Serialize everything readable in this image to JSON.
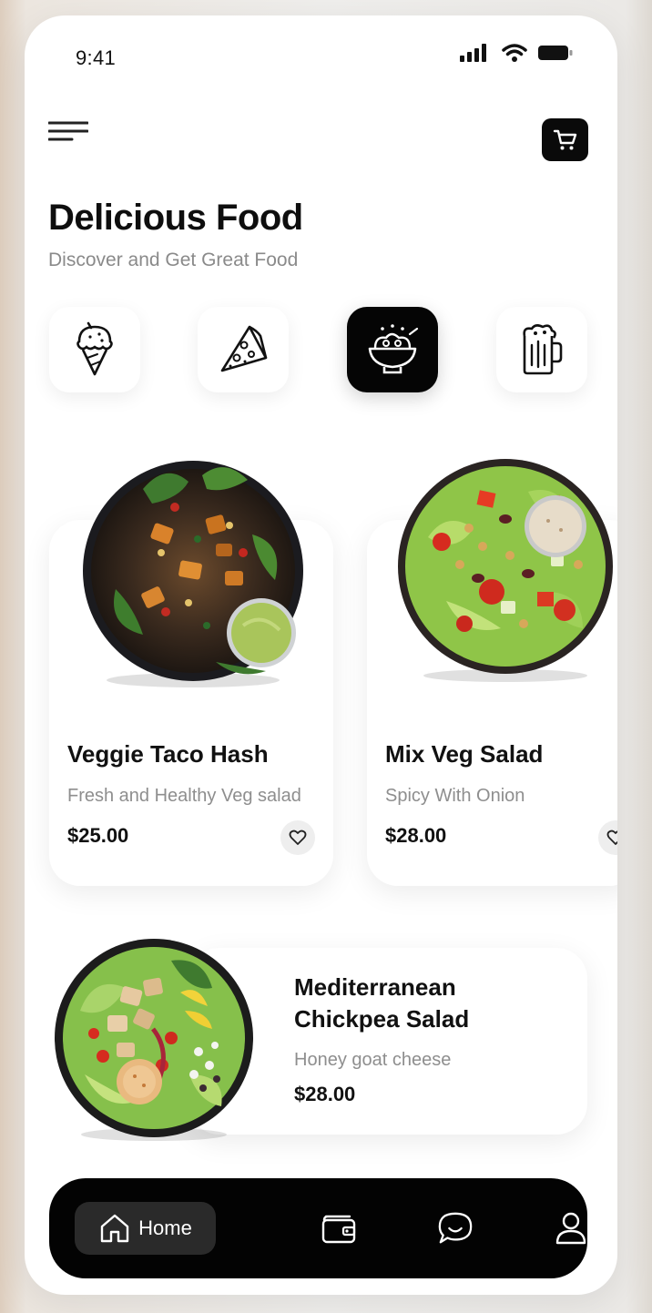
{
  "status_bar": {
    "time": "9:41"
  },
  "header": {
    "title": "Delicious Food",
    "subtitle": "Discover and Get Great Food"
  },
  "categories": [
    {
      "icon": "ice-cream-icon",
      "selected": false
    },
    {
      "icon": "pizza-slice-icon",
      "selected": false
    },
    {
      "icon": "salad-bowl-icon",
      "selected": true
    },
    {
      "icon": "beer-mug-icon",
      "selected": false
    }
  ],
  "featured": [
    {
      "name": "Veggie Taco Hash",
      "description": "Fresh and Healthy Veg salad",
      "price": "$25.00"
    },
    {
      "name": "Mix Veg Salad",
      "description": "Spicy With Onion",
      "price": "$28.00"
    }
  ],
  "popular": {
    "name_line1": "Mediterranean",
    "name_line2": "Chickpea Salad",
    "description": "Honey goat cheese",
    "price": "$28.00"
  },
  "bottom_nav": {
    "home_label": "Home",
    "items": [
      "home-icon",
      "wallet-icon",
      "chat-icon",
      "profile-icon"
    ]
  },
  "colors": {
    "accent": "#050505",
    "muted_text": "#8e8e8e",
    "background": "#ffffff"
  }
}
